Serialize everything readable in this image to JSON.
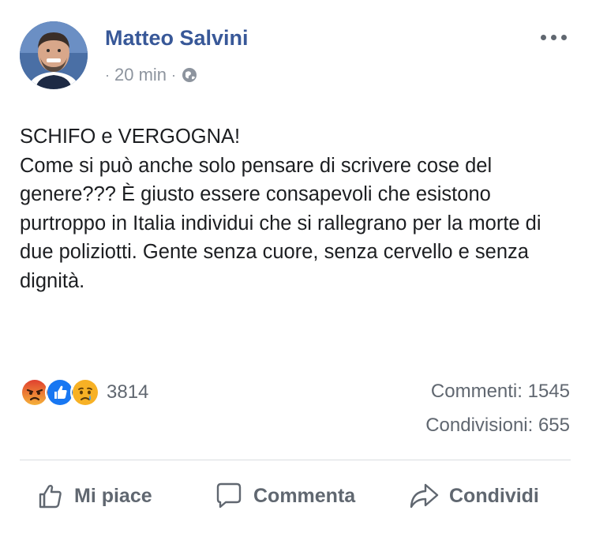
{
  "post": {
    "author": "Matteo Salvini",
    "time": "20 min",
    "separator": "·",
    "text": "SCHIFO e VERGOGNA!\nCome si può anche solo pensare di scrivere cose del genere??? È giusto essere consapevoli che esistono purtroppo in Italia individui che si rallegrano per la morte di due poliziotti. Gente senza cuore, senza cervello e senza dignità."
  },
  "reactions": {
    "icons": [
      "angry-icon",
      "like-icon",
      "sad-icon"
    ],
    "count": "3814"
  },
  "stats": {
    "comments": "Commenti: 1545",
    "shares": "Condivisioni: 655"
  },
  "actions": {
    "like_label": "Mi piace",
    "comment_label": "Commenta",
    "share_label": "Condividi"
  },
  "colors": {
    "author": "#385898",
    "meta": "#8d949e",
    "action": "#606770",
    "like_blue": "#1877f2",
    "angry": "#e9710f",
    "sad": "#f7b125"
  }
}
